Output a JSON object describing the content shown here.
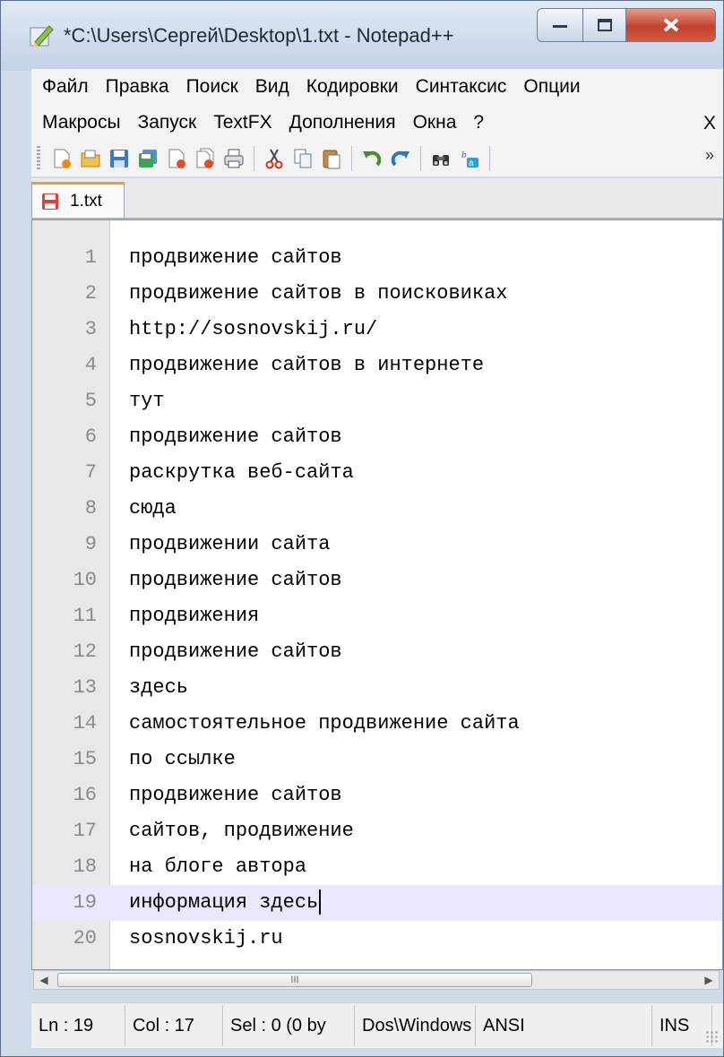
{
  "window": {
    "title": "*C:\\Users\\Сергей\\Desktop\\1.txt - Notepad++"
  },
  "menu": {
    "row1": [
      "Файл",
      "Правка",
      "Поиск",
      "Вид",
      "Кодировки",
      "Синтаксис",
      "Опции"
    ],
    "row2": [
      "Макросы",
      "Запуск",
      "TextFX",
      "Дополнения",
      "Окна",
      "?"
    ],
    "close_doc": "X"
  },
  "toolbar": {
    "icons": [
      "new-file-icon",
      "open-file-icon",
      "save-icon",
      "save-all-icon",
      "close-icon",
      "close-all-icon",
      "print-icon",
      "cut-icon",
      "copy-icon",
      "paste-icon",
      "undo-icon",
      "redo-icon",
      "find-icon",
      "replace-icon"
    ],
    "more": "»"
  },
  "tab": {
    "label": "1.txt"
  },
  "editor": {
    "lines": [
      {
        "n": "1",
        "text": "продвижение сайтов"
      },
      {
        "n": "2",
        "text": "продвижение сайтов в поисковиках"
      },
      {
        "n": "3",
        "text": "http://sosnovskij.ru/"
      },
      {
        "n": "4",
        "text": "продвижение сайтов в интернете"
      },
      {
        "n": "5",
        "text": "тут"
      },
      {
        "n": "6",
        "text": "продвижение сайтов"
      },
      {
        "n": "7",
        "text": "раскрутка веб-сайта"
      },
      {
        "n": "8",
        "text": "сюда"
      },
      {
        "n": "9",
        "text": "продвижении сайта"
      },
      {
        "n": "10",
        "text": "продвижение сайтов"
      },
      {
        "n": "11",
        "text": "продвижения"
      },
      {
        "n": "12",
        "text": "продвижение сайтов"
      },
      {
        "n": "13",
        "text": "здесь"
      },
      {
        "n": "14",
        "text": "самостоятельное продвижение сайта"
      },
      {
        "n": "15",
        "text": "по ссылке"
      },
      {
        "n": "16",
        "text": "продвижение сайтов"
      },
      {
        "n": "17",
        "text": "сайтов, продвижение"
      },
      {
        "n": "18",
        "text": "на блоге автора"
      },
      {
        "n": "19",
        "text": "информация здесь"
      },
      {
        "n": "20",
        "text": "sosnovskij.ru"
      }
    ],
    "current_line": 19
  },
  "scrollbar": {
    "thumb_grip": "III"
  },
  "status": {
    "ln": "Ln : 19",
    "col": "Col : 17",
    "sel": "Sel : 0 (0 by",
    "eol": "Dos\\Windows",
    "encoding": "ANSI",
    "mode": "INS"
  }
}
